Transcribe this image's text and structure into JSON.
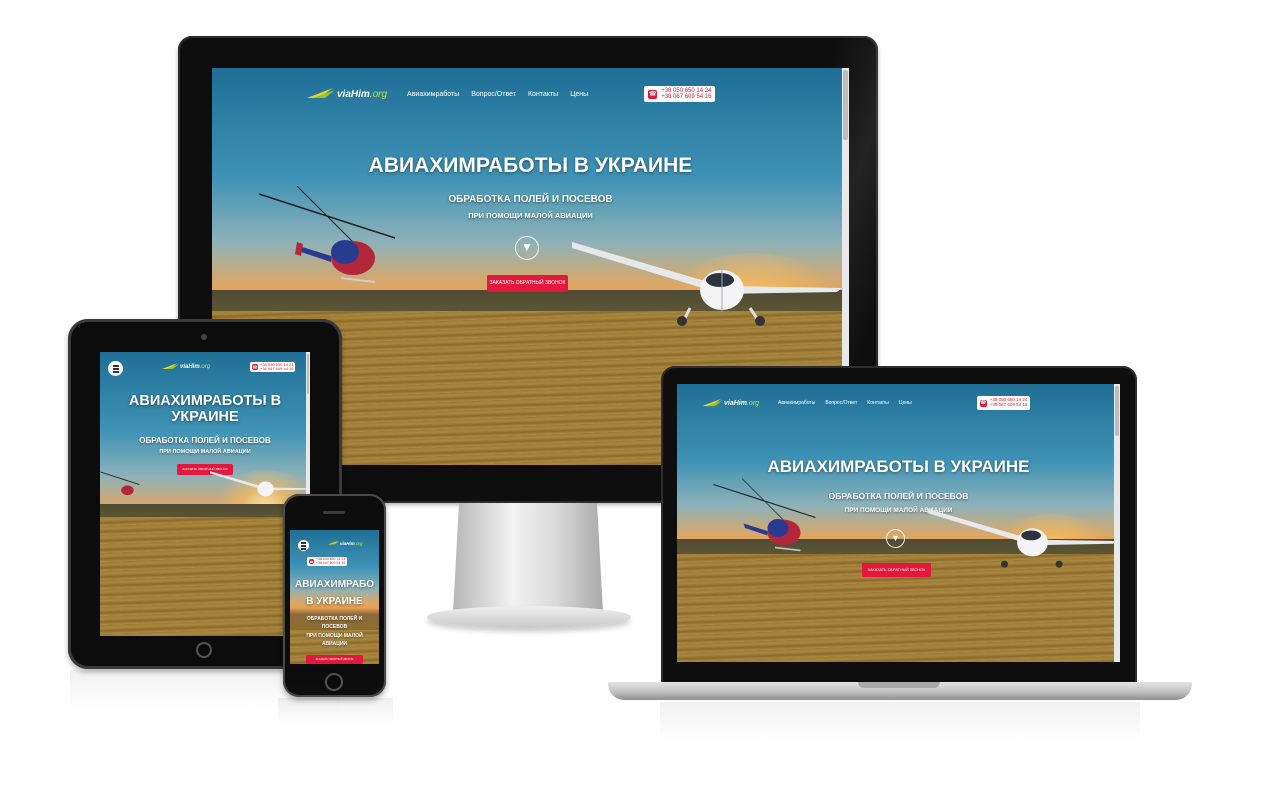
{
  "site": {
    "logo_main": "viaHim",
    "logo_tld": ".org",
    "nav": [
      "Авиахимработы",
      "Вопрос/Ответ",
      "Контакты",
      "Цены"
    ],
    "phones": [
      "+38 050 650 14 24",
      "+38 067 609 54 16"
    ],
    "title": "АВИАХИМРАБОТЫ В УКРАИНЕ",
    "title_tablet_line1": "АВИАХИМРАБОТЫ В",
    "title_tablet_line2": "УКРАИНЕ",
    "title_phone_line1": "АВИАХИМРАБО",
    "title_phone_line2": "В УКРАИНЕ",
    "subtitle": "ОБРАБОТКА ПОЛЕЙ И ПОСЕВОВ",
    "subtitle_phone_line1": "ОБРАБОТКА ПОЛЕЙ И",
    "subtitle_phone_line2": "ПОСЕВОВ",
    "tagline": "ПРИ ПОМОЩИ МАЛОЙ АВИАЦИИ",
    "tagline_phone_line1": "ПРИ ПОМОЩИ МАЛОЙ",
    "tagline_phone_line2": "АВИАЦИИ",
    "cta": "ЗАКАЗАТЬ ОБРАТНЫЙ ЗВОНОК",
    "scroll_icon": "chevron-down-icon",
    "menu_icon": "hamburger-menu-icon",
    "phone_icon": "phone-icon"
  },
  "colors": {
    "accent": "#e3183d",
    "logo_green": "#c8e04a",
    "sky": "#3f93b6",
    "field": "#9c7a36"
  }
}
